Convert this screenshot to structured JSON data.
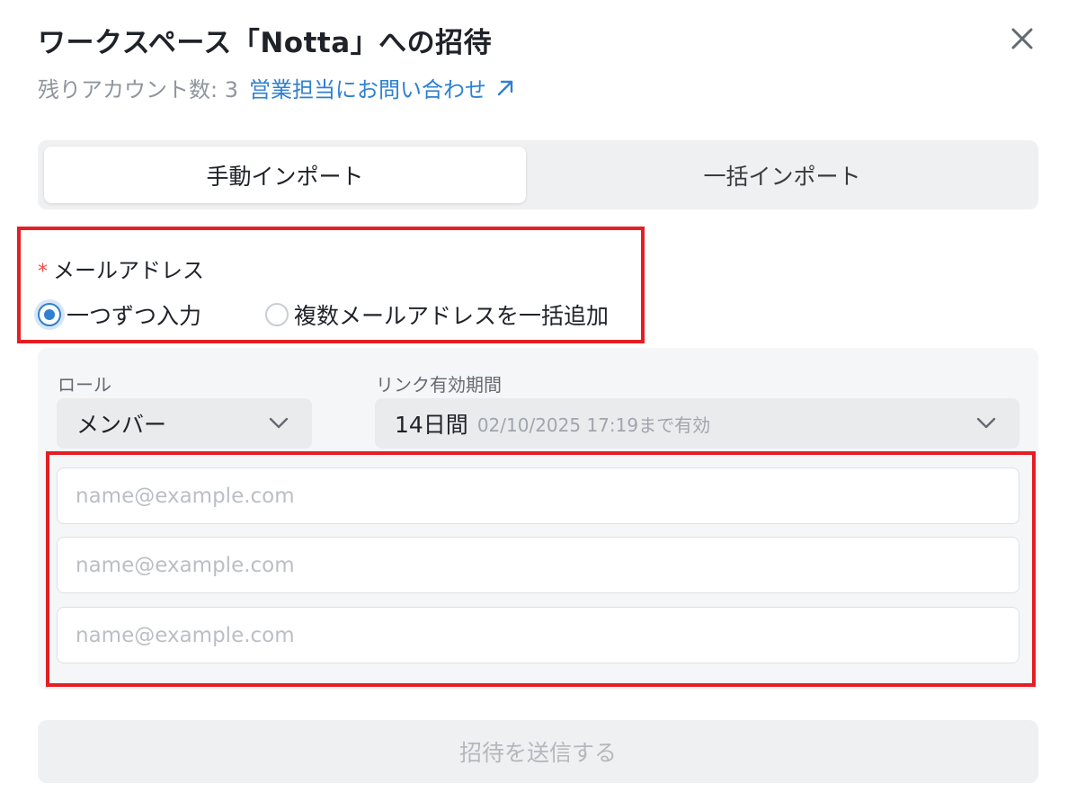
{
  "dialog": {
    "title": "ワークスペース「Notta」への招待",
    "remaining_accounts_label": "残りアカウント数: 3",
    "sales_link_label": "営業担当にお問い合わせ"
  },
  "tabs": [
    {
      "label": "手動インポート",
      "active": true
    },
    {
      "label": "一括インポート",
      "active": false
    }
  ],
  "email_section": {
    "required_mark": "*",
    "label": "メールアドレス",
    "options": [
      {
        "label": "一つずつ入力",
        "selected": true
      },
      {
        "label": "複数メールアドレスを一括追加",
        "selected": false
      }
    ]
  },
  "role": {
    "label": "ロール",
    "value": "メンバー"
  },
  "link_validity": {
    "label": "リンク有効期間",
    "value": "14日間",
    "hint": "02/10/2025 17:19まで有効"
  },
  "email_inputs": [
    {
      "value": "",
      "placeholder": "name@example.com"
    },
    {
      "value": "",
      "placeholder": "name@example.com"
    },
    {
      "value": "",
      "placeholder": "name@example.com"
    }
  ],
  "submit": {
    "label": "招待を送信する",
    "disabled": true
  },
  "icons": {
    "close": "close-icon",
    "external": "external-link-icon",
    "chevron": "chevron-down-icon"
  },
  "colors": {
    "accent": "#2f80d1",
    "required": "#f54a45",
    "highlight_border": "#e31e24"
  }
}
